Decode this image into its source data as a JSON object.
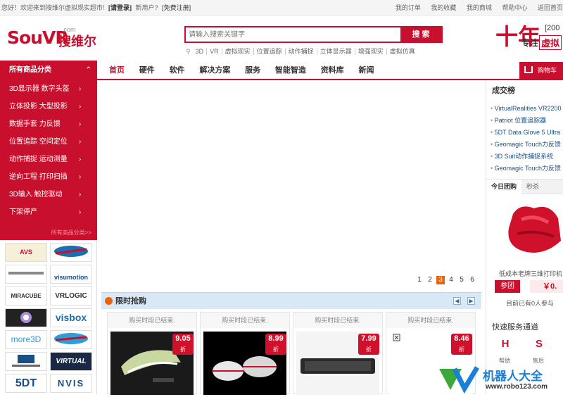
{
  "topbar": {
    "greeting": "您好！欢迎来到搜维尔虚拟现实超市!",
    "login": "[请登录]",
    "new_user": "新用户?",
    "register": "[免费注册]",
    "links": [
      "我的订单",
      "我的收藏",
      "我的商城",
      "帮助中心",
      "返回首页"
    ]
  },
  "logo": {
    "sou": "SouVR",
    "com": ".com",
    "cn": "搜维尔"
  },
  "search": {
    "placeholder": "请输入搜索关键字",
    "button": "搜 索",
    "hotwords": [
      "3D",
      "VR",
      "虚拟现实",
      "位置追踪",
      "动作捕捉",
      "立体显示器",
      "增强现实",
      "虚拟仿真"
    ]
  },
  "brand_right": {
    "big": "十年",
    "slogan": "专注",
    "highlight": "虚拟",
    "year": "[200"
  },
  "nav": {
    "category_title": "所有商品分类",
    "links": [
      "首页",
      "硬件",
      "软件",
      "解决方案",
      "服务",
      "智能智造",
      "资料库",
      "新闻"
    ],
    "cart": "购物车"
  },
  "categories": [
    "3D显示器 数字头盔",
    "立体投影 大型投影",
    "数据手套 力反馈",
    "位置追踪 空间定位",
    "动作捕捉 运动测量",
    "逆向工程 打印扫描",
    "3D输入 触控驱动",
    "下架停产"
  ],
  "categories_all": "所有商品分类>>",
  "brands": [
    {
      "label": "AVS",
      "color": "#c8102e"
    },
    {
      "label": "",
      "color": "#1a6fb0"
    },
    {
      "label": "",
      "color": "#555555"
    },
    {
      "label": "visumotion",
      "color": "#1a4f84"
    },
    {
      "label": "MIRACUBE",
      "color": "#333333"
    },
    {
      "label": "VRLOGIC",
      "color": "#333333"
    },
    {
      "label": "",
      "color": "#7a3a9a"
    },
    {
      "label": "visbox",
      "color": "#1a6fb0"
    },
    {
      "label": "more3D",
      "color": "#2a9fd8"
    },
    {
      "label": "",
      "color": "#c8102e"
    },
    {
      "label": "",
      "color": "#1a4f84"
    },
    {
      "label": "VIRTUAL",
      "color": "#ffffff"
    },
    {
      "label": "5DT",
      "color": "#1a4f84"
    },
    {
      "label": "NVIS",
      "color": "#1a4f84"
    }
  ],
  "banner": {
    "pages": [
      "1",
      "2",
      "3",
      "4",
      "5",
      "6"
    ],
    "current_page": 3
  },
  "flash_sale": {
    "title": "限时抢购",
    "products": [
      {
        "status": "购买时段已结束.",
        "price": "9.05",
        "unit": "折"
      },
      {
        "status": "购买时段已结束.",
        "price": "8.99",
        "unit": "折"
      },
      {
        "status": "购买时段已结束.",
        "price": "7.99",
        "unit": "折"
      },
      {
        "status": "购买时段已结束.",
        "price": "8.46",
        "unit": "折"
      }
    ]
  },
  "ranking": {
    "title": "成交榜",
    "items": [
      "VirtualRealities VR2200",
      "Patriot 位置追踪器",
      "5DT Data Glove 5 Ultra",
      "Geomagic Touch力反馈",
      "3D Suit动作捕捉系统",
      "Geomagic Touch力反馈"
    ]
  },
  "groupbuy": {
    "tabs": [
      "今日团购",
      "秒杀"
    ],
    "product_name": "低成本老牌三维打印机",
    "button": "参团",
    "price": "￥0.",
    "count_text": "目前已有0人参与"
  },
  "service": {
    "title": "快速服务通道",
    "icons": [
      "H",
      "S"
    ],
    "labels": [
      "帮助",
      "售后"
    ]
  },
  "watermark": {
    "text": "机器人大全",
    "url": "www.robo123.com"
  },
  "colors": {
    "primary": "#c8102e",
    "link": "#1a4f84",
    "accent": "#e8630a",
    "flash_header": "#d8e8f6"
  }
}
